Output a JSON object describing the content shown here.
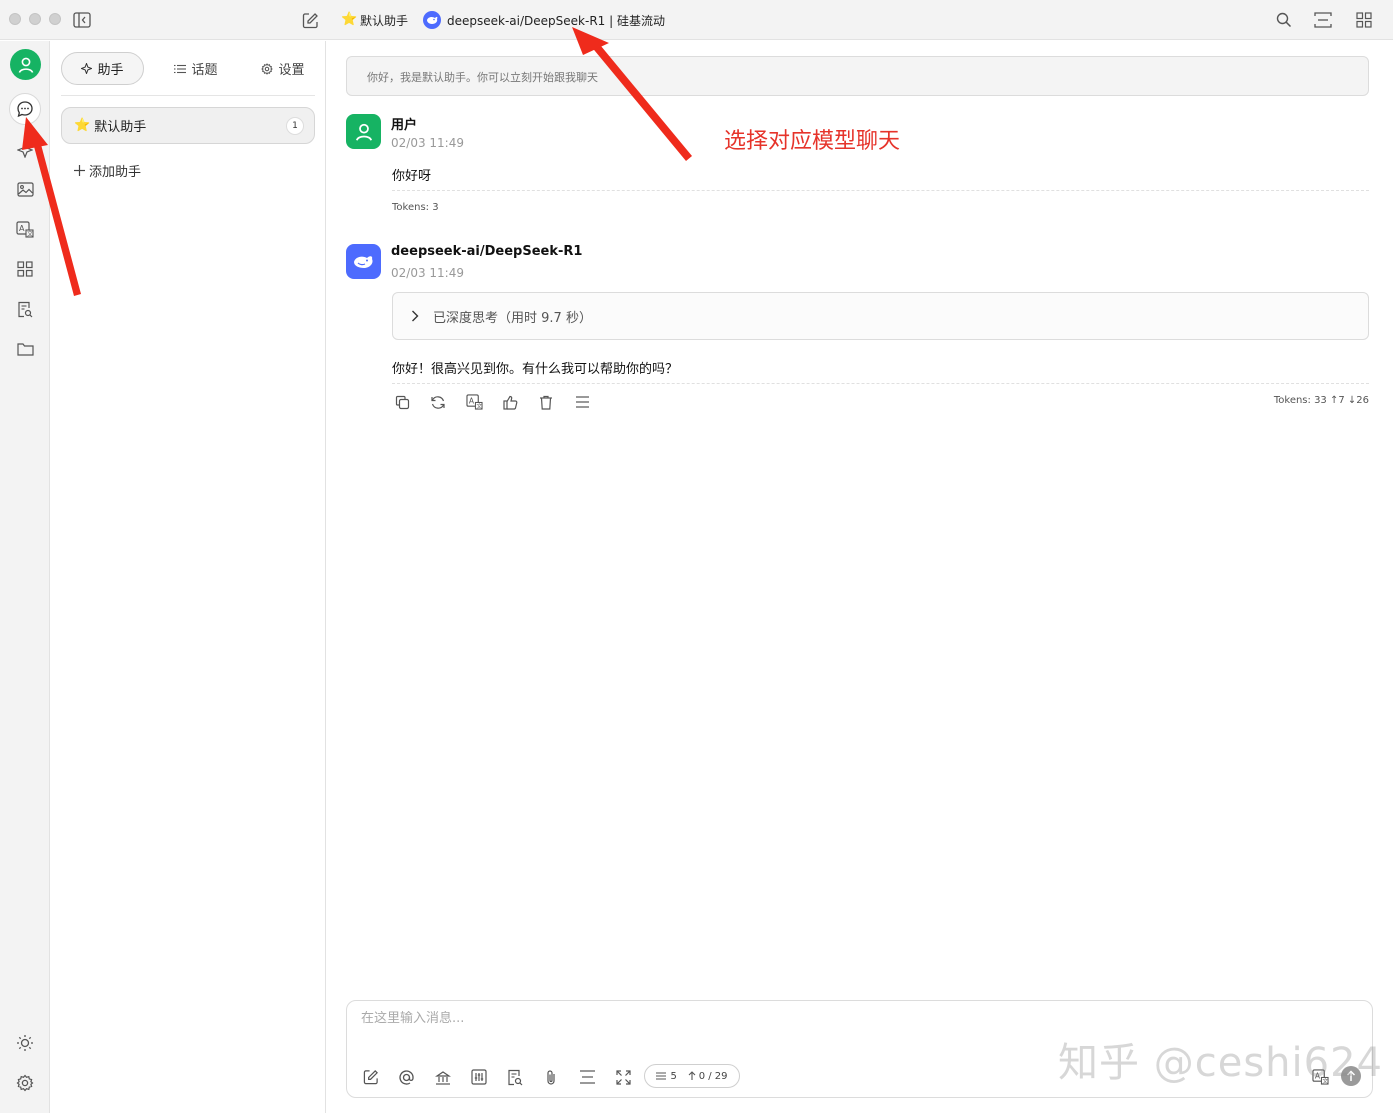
{
  "titlebar": {
    "assistant_title": "默认助手",
    "model_title": "deepseek-ai/DeepSeek-R1 | 硅基流动"
  },
  "panel": {
    "tabs": [
      {
        "label": "助手"
      },
      {
        "label": "话题"
      },
      {
        "label": "设置"
      }
    ],
    "assistant": {
      "name": "默认助手",
      "count": "1"
    },
    "add_label": "添加助手"
  },
  "chat": {
    "system_prompt": "你好，我是默认助手。你可以立刻开始跟我聊天",
    "messages": [
      {
        "name": "用户",
        "time": "02/03 11:49",
        "text": "你好呀",
        "tokens": "Tokens: 3"
      },
      {
        "name": "deepseek-ai/DeepSeek-R1",
        "time": "02/03 11:49",
        "thinking": "已深度思考（用时 9.7 秒）",
        "text": "你好！很高兴见到你。有什么我可以帮助你的吗？",
        "tokens": "Tokens: 33 ↑7 ↓26"
      }
    ]
  },
  "annotation": {
    "text": "选择对应模型聊天",
    "color": "#e6332a"
  },
  "input": {
    "placeholder": "在这里输入消息...",
    "context_count": "5",
    "token_usage": "0 / 29"
  },
  "watermark": "知乎 @ceshi624",
  "colors": {
    "accent_green": "#16b363",
    "deepseek_blue": "#4d6bfe"
  }
}
